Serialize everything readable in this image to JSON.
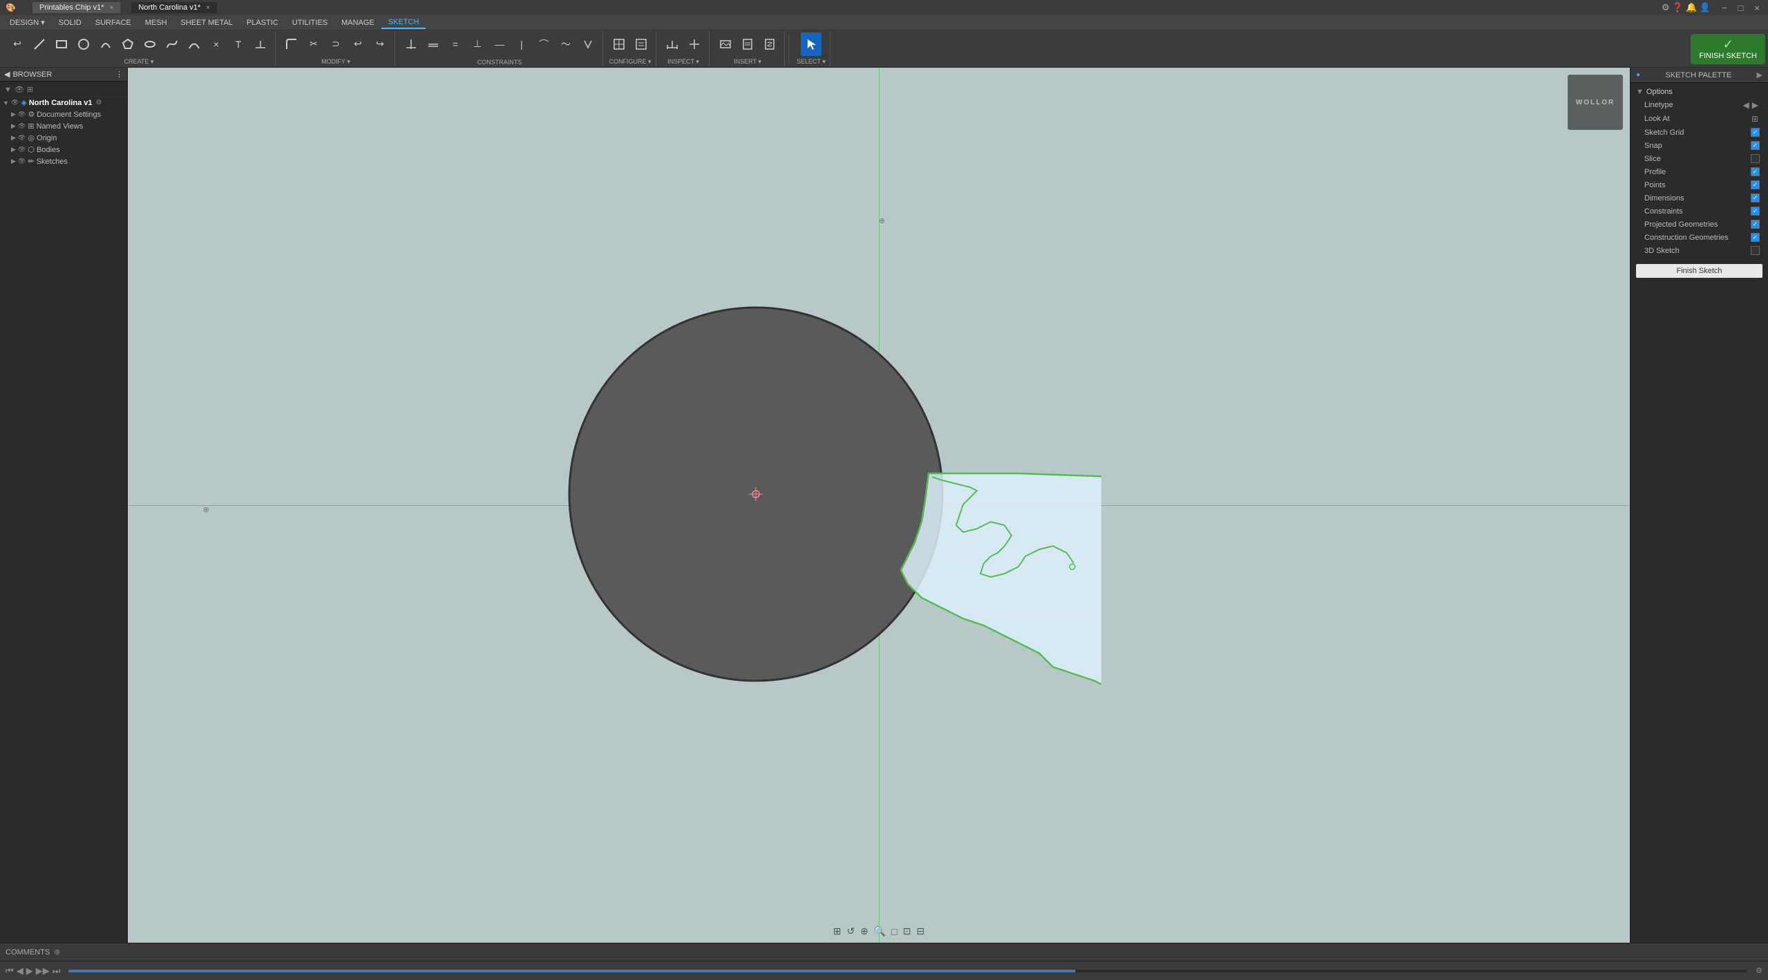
{
  "titlebar": {
    "tabs": [
      {
        "label": "Printables Chip v1*",
        "active": false
      },
      {
        "label": "North Carolina v1*",
        "active": true
      }
    ],
    "close_btn": "×",
    "min_btn": "−",
    "max_btn": "□"
  },
  "menubar": {
    "items": [
      {
        "label": "DESIGN",
        "type": "dropdown"
      },
      {
        "label": "SOLID"
      },
      {
        "label": "SURFACE"
      },
      {
        "label": "MESH"
      },
      {
        "label": "SHEET METAL"
      },
      {
        "label": "PLASTIC"
      },
      {
        "label": "UTILITIES"
      },
      {
        "label": "MANAGE"
      },
      {
        "label": "SKETCH",
        "active": true
      }
    ]
  },
  "toolbar": {
    "groups": [
      {
        "label": "CREATE",
        "icons": [
          "↩",
          "□",
          "○",
          "△",
          "▷",
          "⌒",
          "⌒",
          "⌒",
          "⌒",
          "⌒"
        ]
      },
      {
        "label": "MODIFY",
        "icons": [
          "✂",
          "⊂",
          "↩",
          "↪"
        ]
      },
      {
        "label": "CONSTRAINTS",
        "icons": [
          "⊥",
          "‖",
          "=",
          "⌒",
          "∅",
          "×",
          "↔",
          "↕",
          "⌐"
        ]
      },
      {
        "label": "CONFIGURE",
        "icons": [
          "⊞",
          "⊟"
        ]
      },
      {
        "label": "INSPECT",
        "icons": [
          "📏",
          "📐"
        ]
      },
      {
        "label": "INSERT",
        "icons": [
          "⬚",
          "⬚",
          "⬚"
        ]
      },
      {
        "label": "SELECT",
        "icons": [
          "↖"
        ],
        "active": true
      }
    ],
    "finish_sketch": {
      "label": "FINISH SKETCH",
      "icon": "✓"
    }
  },
  "browser": {
    "title": "BROWSER",
    "collapse_icon": "◀",
    "tree": [
      {
        "label": "North Carolina v1",
        "level": 0,
        "icon": "▶",
        "type": "root",
        "visible": true
      },
      {
        "label": "Document Settings",
        "level": 1,
        "icon": "▶",
        "type": "settings",
        "visible": true
      },
      {
        "label": "Named Views",
        "level": 1,
        "icon": "▶",
        "type": "views",
        "visible": true
      },
      {
        "label": "Origin",
        "level": 1,
        "icon": "▶",
        "type": "origin",
        "visible": true
      },
      {
        "label": "Bodies",
        "level": 1,
        "icon": "▶",
        "type": "bodies",
        "visible": true
      },
      {
        "label": "Sketches",
        "level": 1,
        "icon": "▶",
        "type": "sketches",
        "visible": true
      }
    ]
  },
  "canvas": {
    "background_color": "#c5d5d5",
    "circle_color": "#5a5a5a",
    "nc_shape_color": "#e8f4f8",
    "nc_outline_color": "#55bb55"
  },
  "sketch_palette": {
    "title": "SKETCH PALETTE",
    "options_label": "Options",
    "rows": [
      {
        "label": "Linetype",
        "type": "arrows",
        "checked": null
      },
      {
        "label": "Look At",
        "type": "icon",
        "checked": null
      },
      {
        "label": "Sketch Grid",
        "type": "checkbox",
        "checked": true
      },
      {
        "label": "Snap",
        "type": "checkbox",
        "checked": true
      },
      {
        "label": "Slice",
        "type": "checkbox",
        "checked": false
      },
      {
        "label": "Profile",
        "type": "checkbox",
        "checked": true
      },
      {
        "label": "Points",
        "type": "checkbox",
        "checked": true
      },
      {
        "label": "Dimensions",
        "type": "checkbox",
        "checked": true
      },
      {
        "label": "Constraints",
        "type": "checkbox",
        "checked": true
      },
      {
        "label": "Projected Geometries",
        "type": "checkbox",
        "checked": true
      },
      {
        "label": "Construction Geometries",
        "type": "checkbox",
        "checked": true
      },
      {
        "label": "3D Sketch",
        "type": "checkbox",
        "checked": false
      }
    ],
    "finish_sketch_btn": "Finish Sketch"
  },
  "bottom": {
    "comments_label": "COMMENTS",
    "view_tools": [
      "⊟",
      "↺",
      "⊕",
      "Q",
      "□",
      "⊞",
      "⊡"
    ],
    "timeline_btns": [
      "⏮",
      "◀",
      "▶",
      "▶▶",
      "⏭"
    ],
    "status_right": ""
  },
  "view_cube": {
    "label": "WOLLOR"
  }
}
